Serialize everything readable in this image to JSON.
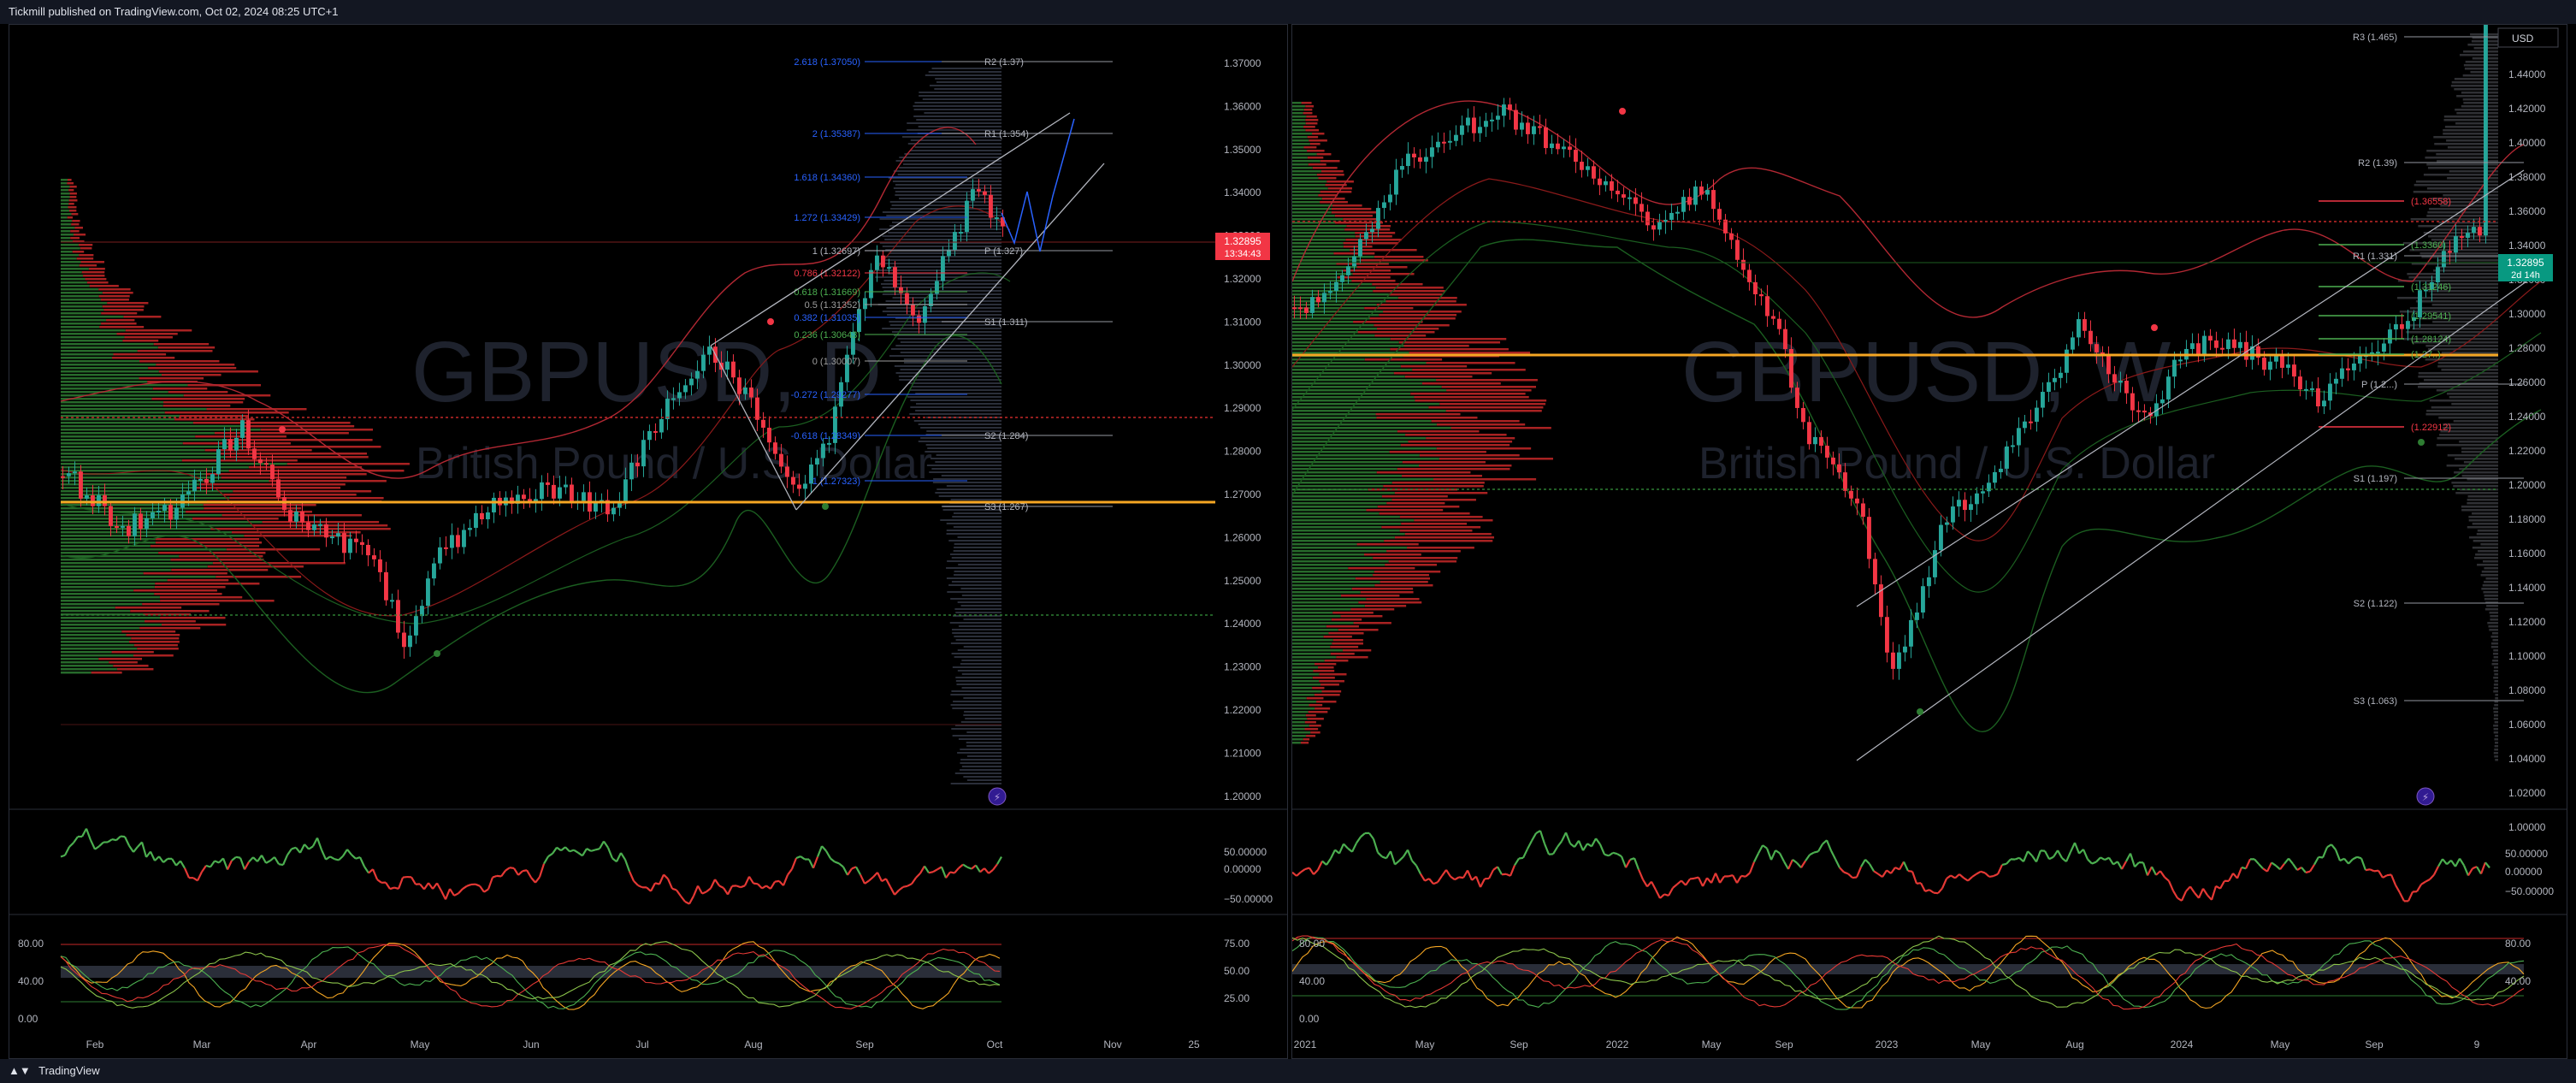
{
  "header": {
    "publisher": "Tickmill published on TradingView.com, Oct 02, 2024 08:25 UTC+1"
  },
  "footer": {
    "brand": "TradingView"
  },
  "left": {
    "watermark_symbol": "GBPUSD, D",
    "watermark_name": "British Pound / U.S. Dollar",
    "price_axis": [
      "1.37000",
      "1.36000",
      "1.35000",
      "1.34000",
      "1.33000",
      "1.32000",
      "1.31000",
      "1.30000",
      "1.29000",
      "1.28000",
      "1.27000",
      "1.26000",
      "1.25000",
      "1.24000",
      "1.23000",
      "1.22000",
      "1.21000",
      "1.20000"
    ],
    "price_label": "1.32895",
    "price_countdown": "13:34:43",
    "time_axis": [
      "Feb",
      "Mar",
      "Apr",
      "May",
      "Jun",
      "Jul",
      "Aug",
      "Sep",
      "Oct",
      "Nov",
      "25"
    ],
    "fib_labels": [
      "2.618 (1.37050)",
      "2 (1.35387)",
      "1.618 (1.34360)",
      "1.272 (1.33429)",
      "1 (1.32697)",
      "0.786 (1.32122)",
      "0.618 (1.31669)",
      "0.5 (1.31352)",
      "0.382 (1.31035)",
      "0.236 (1.30643)",
      "0 (1.30007)",
      "-0.272 (1.29277)",
      "-0.618 (1.28349)",
      "-1 (1.27323)"
    ],
    "pivots": [
      "R2 (1.37)",
      "R1 (1.354)",
      "P (1.327)",
      "S1 (1.311)",
      "S2 (1.284)",
      "S3 (1.267)"
    ],
    "osc1_axis": [
      "50.00000",
      "0.00000",
      "−50.00000"
    ],
    "osc2_axis_left": [
      "80.00",
      "40.00",
      "0.00"
    ],
    "osc2_axis_right": [
      "75.00",
      "50.00",
      "25.00"
    ]
  },
  "right": {
    "watermark_symbol": "GBPUSD, W",
    "watermark_name": "British Pound / U.S. Dollar",
    "currency": "USD",
    "price_axis": [
      "1.44000",
      "1.42000",
      "1.40000",
      "1.38000",
      "1.36000",
      "1.34000",
      "1.32000",
      "1.30000",
      "1.28000",
      "1.26000",
      "1.24000",
      "1.22000",
      "1.20000",
      "1.18000",
      "1.16000",
      "1.14000",
      "1.12000",
      "1.10000",
      "1.08000",
      "1.06000",
      "1.04000",
      "1.02000",
      "1.00000"
    ],
    "price_label": "1.32895",
    "price_countdown": "2d 14h",
    "time_axis": [
      "2021",
      "May",
      "Sep",
      "2022",
      "May",
      "Sep",
      "2023",
      "May",
      "Aug",
      "2024",
      "May",
      "Sep",
      "9"
    ],
    "pivots": [
      "R3 (1.465)",
      "R2 (1.39)",
      "R1 (1.331)",
      "P (1.2...)",
      "S1 (1.197)",
      "S2 (1.122)",
      "S3 (1.063)"
    ],
    "fib_labels": [
      "(1.36558)",
      "(1.3360)",
      "(1.31246)",
      "(1.29541)",
      "(1.28124)",
      "(1.27..)",
      "(1.22912)"
    ],
    "osc1_axis": [
      "50.00000",
      "0.00000",
      "−50.00000"
    ],
    "osc2_axis": [
      "80.00",
      "40.00",
      "0.00"
    ]
  },
  "colors": {
    "up": "#26a69a",
    "down": "#ef5350",
    "orange": "#f5a623",
    "price_left": "#f23645",
    "price_right": "#089981"
  }
}
